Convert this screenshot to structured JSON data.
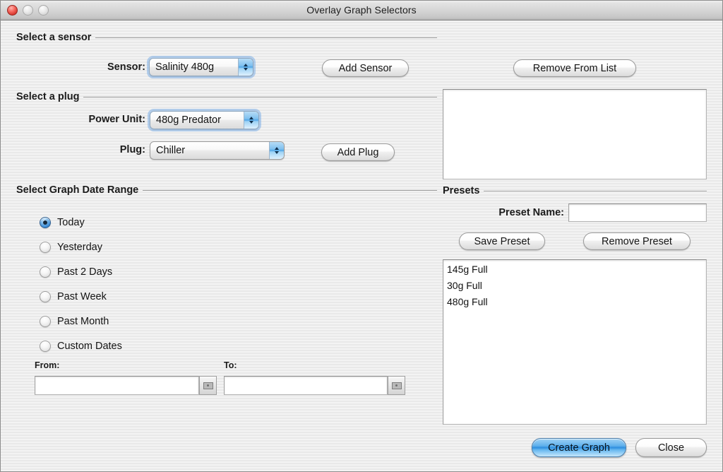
{
  "window": {
    "title": "Overlay Graph Selectors",
    "controls": {
      "close": "close",
      "minimize": "minimize",
      "zoom": "zoom"
    }
  },
  "sensor_group": {
    "header": "Select a sensor",
    "sensor_label": "Sensor:",
    "sensor_value": "Salinity 480g",
    "add_sensor_button": "Add Sensor"
  },
  "plug_group": {
    "header": "Select a plug",
    "power_unit_label": "Power Unit:",
    "power_unit_value": "480g Predator",
    "plug_label": "Plug:",
    "plug_value": "Chiller",
    "add_plug_button": "Add Plug"
  },
  "selection_list": {
    "remove_button": "Remove From List",
    "items": []
  },
  "date_group": {
    "header": "Select Graph Date Range",
    "options": [
      {
        "label": "Today",
        "selected": true
      },
      {
        "label": "Yesterday",
        "selected": false
      },
      {
        "label": "Past 2 Days",
        "selected": false
      },
      {
        "label": "Past Week",
        "selected": false
      },
      {
        "label": "Past Month",
        "selected": false
      },
      {
        "label": "Custom Dates",
        "selected": false
      }
    ],
    "from_label": "From:",
    "from_value": "",
    "to_label": "To:",
    "to_value": "",
    "date_picker_icon": "calendar-icon"
  },
  "presets_group": {
    "header": "Presets",
    "preset_name_label": "Preset Name:",
    "preset_name_value": "",
    "save_button": "Save Preset",
    "remove_button": "Remove Preset",
    "items": [
      "145g Full",
      "30g Full",
      "480g Full"
    ]
  },
  "footer": {
    "create_graph_button": "Create Graph",
    "close_button": "Close"
  },
  "colors": {
    "window_background": "#eeeeee",
    "default_button_blue": "#2e8ede",
    "popup_arrow_blue": "#4ea5e6",
    "radio_selected_blue": "#3f8ed6",
    "close_light_red": "#d3352c"
  }
}
